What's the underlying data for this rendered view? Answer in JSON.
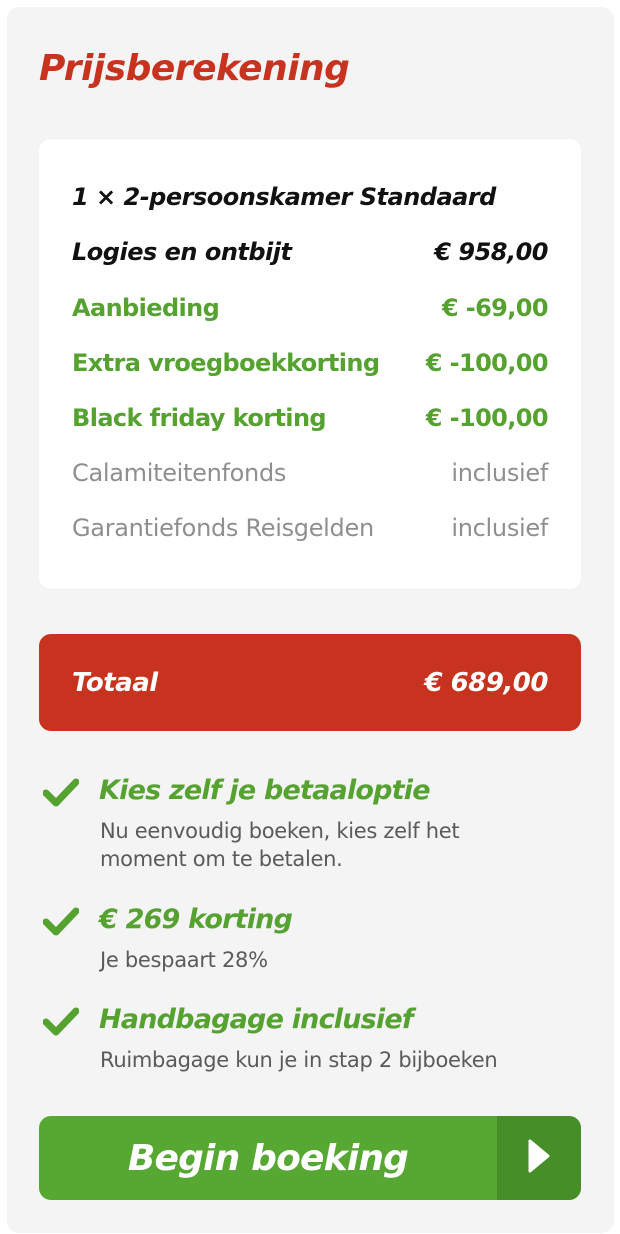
{
  "title": "Prijsberekening",
  "breakdown": {
    "room": "1 × 2-persoonskamer Standaard",
    "base": {
      "label": "Logies en ontbijt",
      "value": "€ 958,00"
    },
    "discounts": [
      {
        "label": "Aanbieding",
        "value": "€ -69,00"
      },
      {
        "label": "Extra vroegboekkorting",
        "value": "€ -100,00"
      },
      {
        "label": "Black friday korting",
        "value": "€ -100,00"
      }
    ],
    "included": [
      {
        "label": "Calamiteitenfonds",
        "value": "inclusief"
      },
      {
        "label": "Garantiefonds Reisgelden",
        "value": "inclusief"
      }
    ]
  },
  "total": {
    "label": "Totaal",
    "value": "€ 689,00"
  },
  "benefits": [
    {
      "title": "Kies zelf je betaaloptie",
      "text": "Nu eenvoudig boeken, kies zelf het moment om te betalen."
    },
    {
      "title": "€ 269 korting",
      "text": "Je bespaart 28%"
    },
    {
      "title": "Handbagage inclusief",
      "text": "Ruimbagage kun je in stap 2 bijboeken"
    }
  ],
  "cta": {
    "label": "Begin boeking",
    "icon": "play-arrow-icon"
  },
  "colors": {
    "brand_red": "#c8331f",
    "green": "#56a231",
    "cta_green": "#56a833",
    "cta_dark_green": "#468f28",
    "muted_grey": "#8f8f8f",
    "panel_bg": "#f4f4f4"
  }
}
